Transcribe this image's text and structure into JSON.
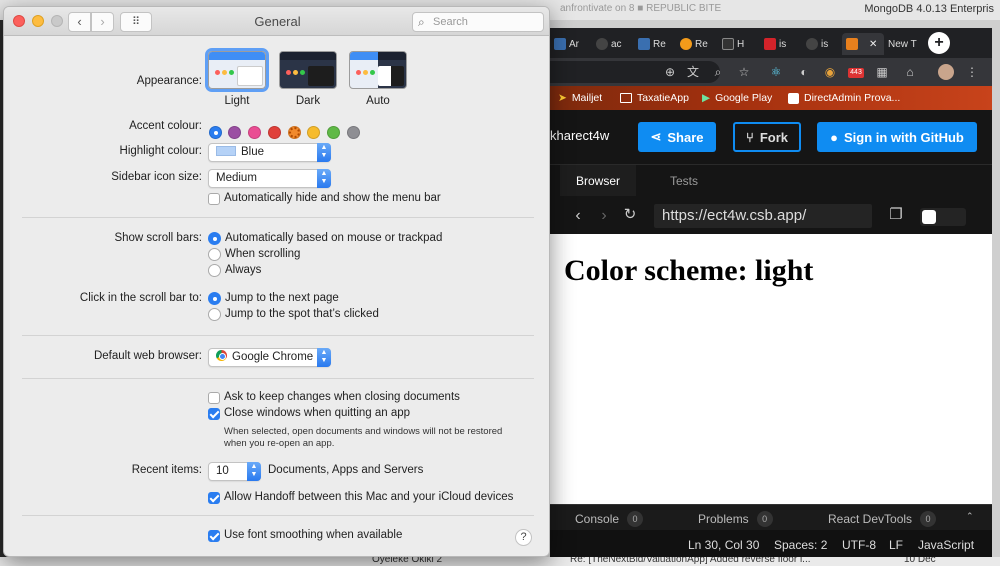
{
  "background": {
    "faded_title": "anfrontivate on 8 ■ REPUBLIC BITE",
    "mongo_title": "MongoDB 4.0.13 Enterpris",
    "mail_sender": "Oyeleke Okiki 2",
    "mail_subject": "Re: [TheNextBid/ValuationApp] Added reverse floor i...",
    "mail_date": "10 Dec"
  },
  "browser": {
    "tabs": [
      "Ar",
      "ac",
      "Re",
      "Re",
      "H",
      "is",
      "is",
      "",
      "New T"
    ],
    "badge": "443",
    "bookmarks": [
      "Mailjet",
      "TaxatieApp",
      "Google Play",
      "DirectAdmin Prova..."
    ]
  },
  "codesandbox": {
    "title": "kharect4w",
    "share": "Share",
    "fork": "Fork",
    "signin": "Sign in with GitHub",
    "tabs": [
      "Browser",
      "Tests"
    ],
    "url": "https://ect4w.csb.app/",
    "heading": "Color scheme: light",
    "devtools": [
      {
        "label": "Console",
        "count": "0"
      },
      {
        "label": "Problems",
        "count": "0"
      },
      {
        "label": "React DevTools",
        "count": "0"
      }
    ],
    "status": [
      "Ln 30, Col 30",
      "Spaces: 2",
      "UTF-8",
      "LF",
      "JavaScript"
    ]
  },
  "prefs": {
    "title": "General",
    "search_placeholder": "Search",
    "appearance": {
      "label": "Appearance:",
      "options": [
        "Light",
        "Dark",
        "Auto"
      ],
      "selected": "Light"
    },
    "accent": {
      "label": "Accent colour:",
      "selected": "blue",
      "colors": [
        "#2a7df0",
        "#9b4fa3",
        "#ea4d93",
        "#e0403a",
        "#f28a2c",
        "#f6bb2c",
        "#5fb946",
        "#8e8e93"
      ]
    },
    "highlight": {
      "label": "Highlight colour:",
      "value": "Blue"
    },
    "sidebar_icon": {
      "label": "Sidebar icon size:",
      "value": "Medium"
    },
    "auto_hide_menu": "Automatically hide and show the menu bar",
    "scroll_bars": {
      "label": "Show scroll bars:",
      "options": [
        "Automatically based on mouse or trackpad",
        "When scrolling",
        "Always"
      ],
      "selected": 0
    },
    "click_scroll": {
      "label": "Click in the scroll bar to:",
      "options": [
        "Jump to the next page",
        "Jump to the spot that’s clicked"
      ],
      "selected": 0
    },
    "default_browser": {
      "label": "Default web browser:",
      "value": "Google Chrome"
    },
    "ask_keep_changes": "Ask to keep changes when closing documents",
    "close_windows": "Close windows when quitting an app",
    "close_windows_note": [
      "When selected, open documents and windows will not be restored",
      "when you re-open an app."
    ],
    "recent_items": {
      "label": "Recent items:",
      "value": "10",
      "suffix": "Documents, Apps and Servers"
    },
    "handoff": "Allow Handoff between this Mac and your iCloud devices",
    "font_smoothing": "Use font smoothing when available",
    "accent_color": "#2a7df0"
  }
}
